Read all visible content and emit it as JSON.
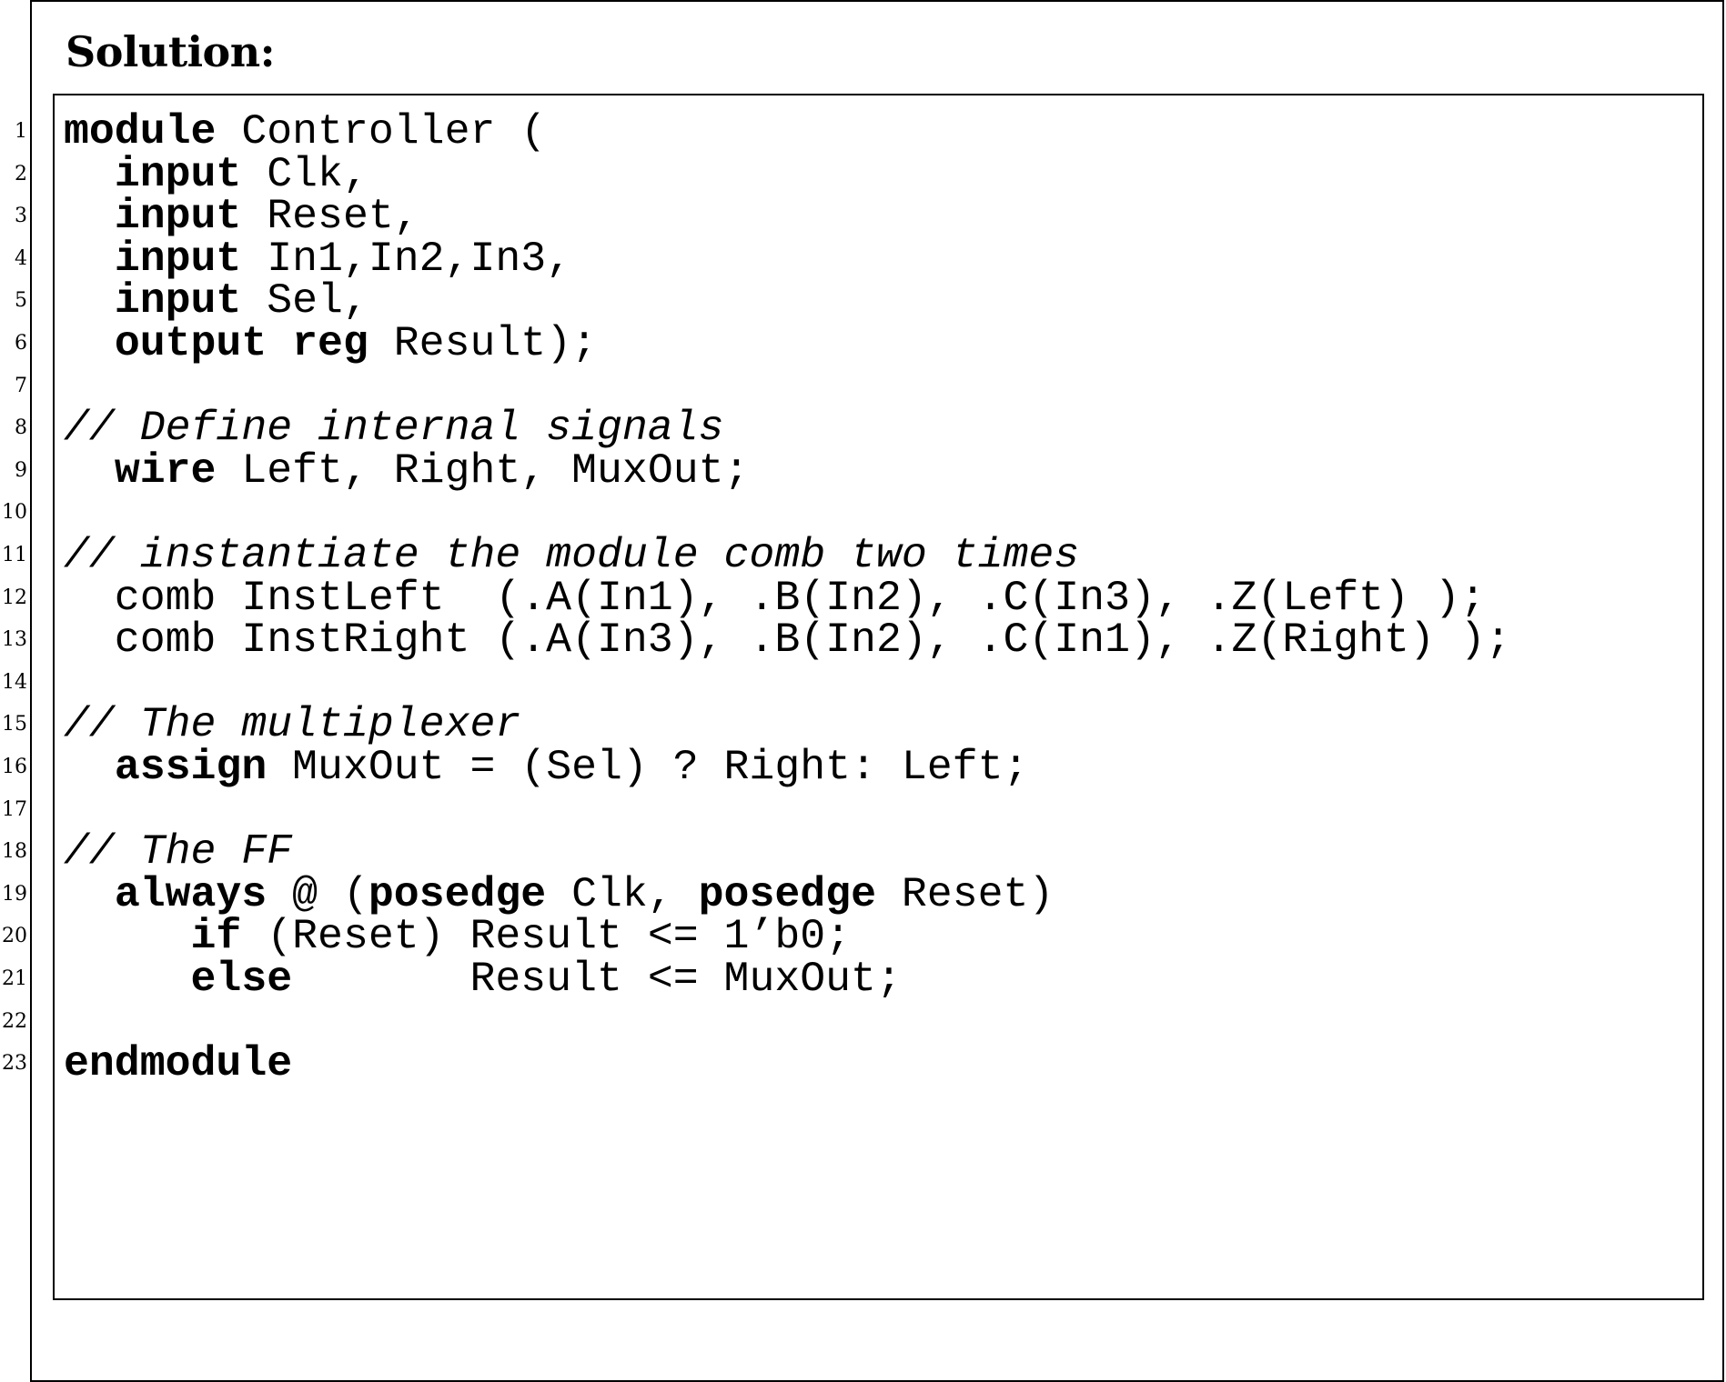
{
  "heading": "Solution:",
  "line_numbers": [
    "1",
    "2",
    "3",
    "4",
    "5",
    "6",
    "7",
    "8",
    "9",
    "10",
    "11",
    "12",
    "13",
    "14",
    "15",
    "16",
    "17",
    "18",
    "19",
    "20",
    "21",
    "22",
    "23"
  ],
  "code": [
    [
      {
        "t": "module",
        "k": "kw"
      },
      {
        "t": " Controller (",
        "k": "text"
      }
    ],
    [
      {
        "t": "  ",
        "k": "text"
      },
      {
        "t": "input",
        "k": "kw"
      },
      {
        "t": " Clk,",
        "k": "text"
      }
    ],
    [
      {
        "t": "  ",
        "k": "text"
      },
      {
        "t": "input",
        "k": "kw"
      },
      {
        "t": " Reset,",
        "k": "text"
      }
    ],
    [
      {
        "t": "  ",
        "k": "text"
      },
      {
        "t": "input",
        "k": "kw"
      },
      {
        "t": " In1,In2,In3,",
        "k": "text"
      }
    ],
    [
      {
        "t": "  ",
        "k": "text"
      },
      {
        "t": "input",
        "k": "kw"
      },
      {
        "t": " Sel,",
        "k": "text"
      }
    ],
    [
      {
        "t": "  ",
        "k": "text"
      },
      {
        "t": "output",
        "k": "kw"
      },
      {
        "t": " ",
        "k": "text"
      },
      {
        "t": "reg",
        "k": "kw"
      },
      {
        "t": " Result);",
        "k": "text"
      }
    ],
    [],
    [
      {
        "t": "// Define internal signals",
        "k": "comment"
      }
    ],
    [
      {
        "t": "  ",
        "k": "text"
      },
      {
        "t": "wire",
        "k": "kw"
      },
      {
        "t": " Left, Right, MuxOut;",
        "k": "text"
      }
    ],
    [],
    [
      {
        "t": "// instantiate the module comb two times",
        "k": "comment"
      }
    ],
    [
      {
        "t": "  comb InstLeft  (.A(In1), .B(In2), .C(In3), .Z(Left) );",
        "k": "text"
      }
    ],
    [
      {
        "t": "  comb InstRight (.A(In3), .B(In2), .C(In1), .Z(Right) );",
        "k": "text"
      }
    ],
    [],
    [
      {
        "t": "// The multiplexer",
        "k": "comment"
      }
    ],
    [
      {
        "t": "  ",
        "k": "text"
      },
      {
        "t": "assign",
        "k": "kw"
      },
      {
        "t": " MuxOut = (Sel) ? Right: Left;",
        "k": "text"
      }
    ],
    [],
    [
      {
        "t": "// The FF",
        "k": "comment"
      }
    ],
    [
      {
        "t": "  ",
        "k": "text"
      },
      {
        "t": "always",
        "k": "kw"
      },
      {
        "t": " @ (",
        "k": "text"
      },
      {
        "t": "posedge",
        "k": "kw"
      },
      {
        "t": " Clk, ",
        "k": "text"
      },
      {
        "t": "posedge",
        "k": "kw"
      },
      {
        "t": " Reset)",
        "k": "text"
      }
    ],
    [
      {
        "t": "     ",
        "k": "text"
      },
      {
        "t": "if",
        "k": "kw"
      },
      {
        "t": " (Reset) Result <= 1’b0;",
        "k": "text"
      }
    ],
    [
      {
        "t": "     ",
        "k": "text"
      },
      {
        "t": "else",
        "k": "kw"
      },
      {
        "t": "       Result <= MuxOut;",
        "k": "text"
      }
    ],
    [],
    [
      {
        "t": "endmodule",
        "k": "kw"
      }
    ]
  ]
}
